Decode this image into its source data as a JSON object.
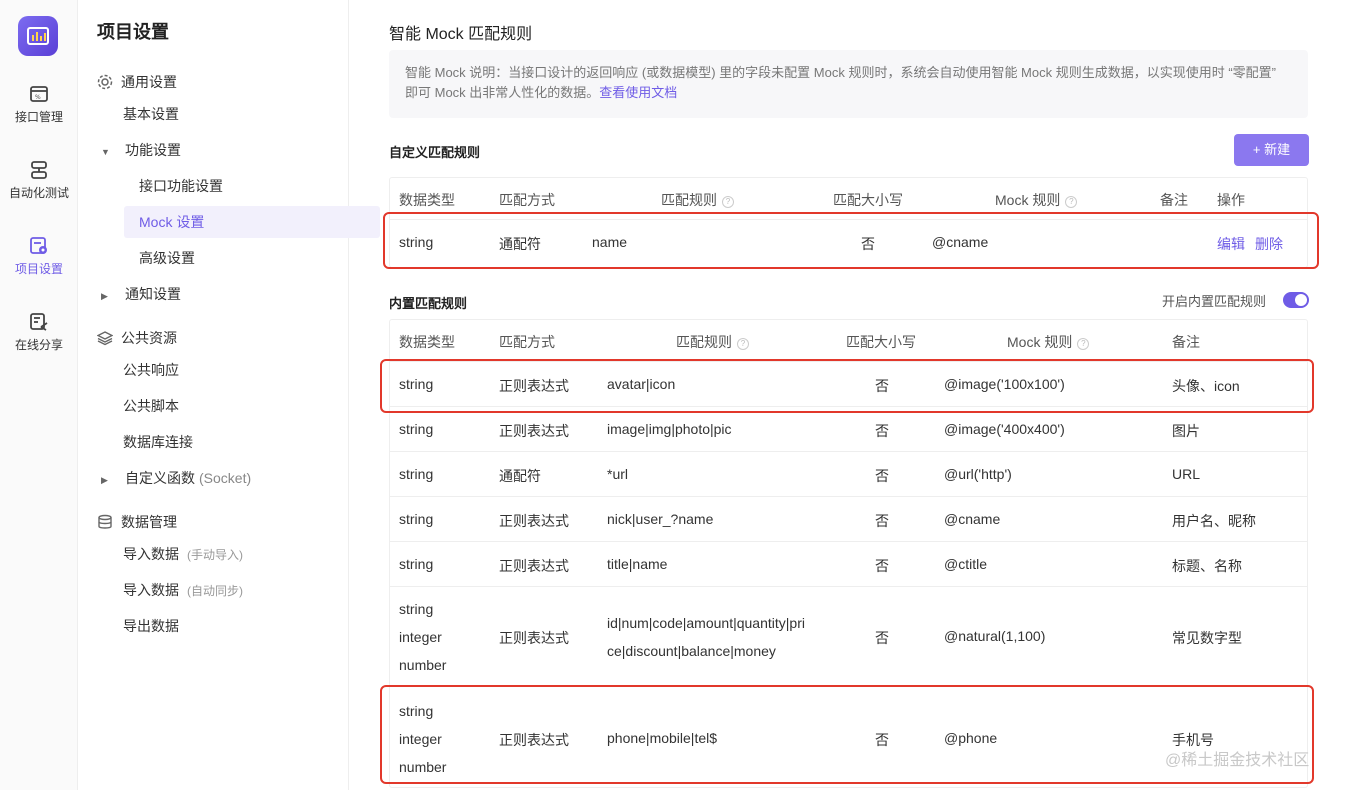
{
  "rail": {
    "items": [
      {
        "label": "接口管理",
        "icon": "api-icon"
      },
      {
        "label": "自动化测试",
        "icon": "automation-icon"
      },
      {
        "label": "项目设置",
        "icon": "project-settings-icon"
      },
      {
        "label": "在线分享",
        "icon": "share-icon"
      }
    ],
    "active_color": "#6f5ce6"
  },
  "sidebar": {
    "title": "项目设置",
    "general": "通用设置",
    "basic": "基本设置",
    "features": "功能设置",
    "api_features": "接口功能设置",
    "mock": "Mock 设置",
    "advanced": "高级设置",
    "notify": "通知设置",
    "public": "公共资源",
    "public_response": "公共响应",
    "public_script": "公共脚本",
    "db_conn": "数据库连接",
    "custom_func": "自定义函数",
    "custom_func_suffix": "(Socket)",
    "data_mgmt": "数据管理",
    "import1": "导入数据",
    "import1_note": "(手动导入)",
    "import2": "导入数据",
    "import2_note": "(自动同步)",
    "export": "导出数据"
  },
  "main": {
    "title": "智能 Mock 匹配规则",
    "note": "智能 Mock 说明：当接口设计的返回响应 (或数据模型) 里的字段未配置 Mock 规则时，系统会自动使用智能 Mock 规则生成数据，以实现使用时 “零配置” 即可 Mock 出非常人性化的数据。",
    "note_link": "查看使用文档",
    "custom_title": "自定义匹配规则",
    "new_button": "+ 新建",
    "builtin_title": "内置匹配规则",
    "builtin_toggle_label": "开启内置匹配规则",
    "builtin_toggle_on": true
  },
  "custom_table": {
    "headers": [
      "数据类型",
      "匹配方式",
      "匹配规则",
      "匹配大小写",
      "Mock 规则",
      "备注",
      "操作"
    ],
    "rows": [
      {
        "type": "string",
        "method": "通配符",
        "rule": "name",
        "case": "否",
        "mock": "@cname",
        "note": "",
        "edit": "编辑",
        "delete": "删除"
      }
    ]
  },
  "builtin_table": {
    "headers": [
      "数据类型",
      "匹配方式",
      "匹配规则",
      "匹配大小写",
      "Mock 规则",
      "备注"
    ],
    "rows": [
      {
        "type1": "string",
        "method": "正则表达式",
        "rule1": "avatar|icon",
        "case": "否",
        "mock": "@image('100x100')",
        "note": "头像、icon"
      },
      {
        "type1": "string",
        "method": "正则表达式",
        "rule1": "image|img|photo|pic",
        "case": "否",
        "mock": "@image('400x400')",
        "note": "图片"
      },
      {
        "type1": "string",
        "method": "通配符",
        "rule1": "*url",
        "case": "否",
        "mock": "@url('http')",
        "note": "URL"
      },
      {
        "type1": "string",
        "method": "正则表达式",
        "rule1": "nick|user_?name",
        "case": "否",
        "mock": "@cname",
        "note": "用户名、昵称"
      },
      {
        "type1": "string",
        "method": "正则表达式",
        "rule1": "title|name",
        "case": "否",
        "mock": "@ctitle",
        "note": "标题、名称"
      },
      {
        "type1": "string",
        "type2": "integer",
        "type3": "number",
        "method": "正则表达式",
        "rule1": "id|num|code|amount|quantity|pri",
        "rule2": "ce|discount|balance|money",
        "case": "否",
        "mock": "@natural(1,100)",
        "note": "常见数字型"
      },
      {
        "type1": "string",
        "type2": "integer",
        "type3": "number",
        "method": "正则表达式",
        "rule1": "phone|mobile|tel$",
        "case": "否",
        "mock": "@phone",
        "note": "手机号"
      }
    ]
  },
  "watermark": "@稀土掘金技术社区",
  "highlight_color": "#e2382b"
}
